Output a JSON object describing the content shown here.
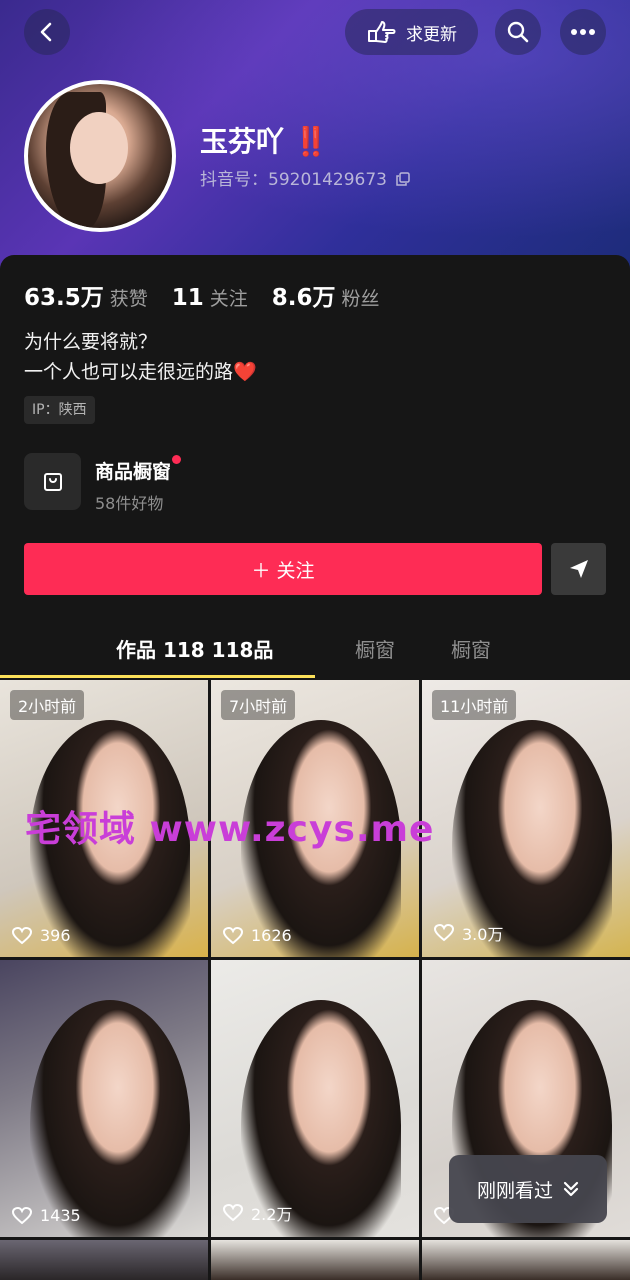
{
  "header": {
    "update_label": "求更新",
    "colors": {
      "accent": "#fe2c55",
      "tab_indicator": "#fce15a",
      "hero_bg": "#3a2a8e"
    }
  },
  "profile": {
    "name": "玉芬吖",
    "name_badge": "‼️",
    "douyin_id": "抖音号：59201429673",
    "stats": [
      {
        "value": "63.5万",
        "label": "获赞"
      },
      {
        "value": "11",
        "label": "关注"
      },
      {
        "value": "8.6万",
        "label": "粉丝"
      }
    ],
    "bio_line1": "为什么要将就？",
    "bio_line2": "一个人也可以走很远的路❤️",
    "ip": "IP：陕西"
  },
  "shop": {
    "title": "商品橱窗",
    "subtitle": "58件好物"
  },
  "actions": {
    "follow_label": "＋ 关注"
  },
  "tabs": [
    {
      "label": "作品 118 118品"
    },
    {
      "label": "橱窗"
    },
    {
      "label": "橱窗"
    }
  ],
  "videos": [
    {
      "time": "2小时前",
      "likes": "396"
    },
    {
      "time": "7小时前",
      "likes": "1626"
    },
    {
      "time": "11小时前",
      "likes": "3.0万"
    },
    {
      "time": "",
      "likes": "1435"
    },
    {
      "time": "",
      "likes": "2.2万"
    },
    {
      "time": "",
      "likes": ""
    }
  ],
  "watermark": "宅领域 www.zcys.me",
  "just_viewed_label": "刚刚看过"
}
